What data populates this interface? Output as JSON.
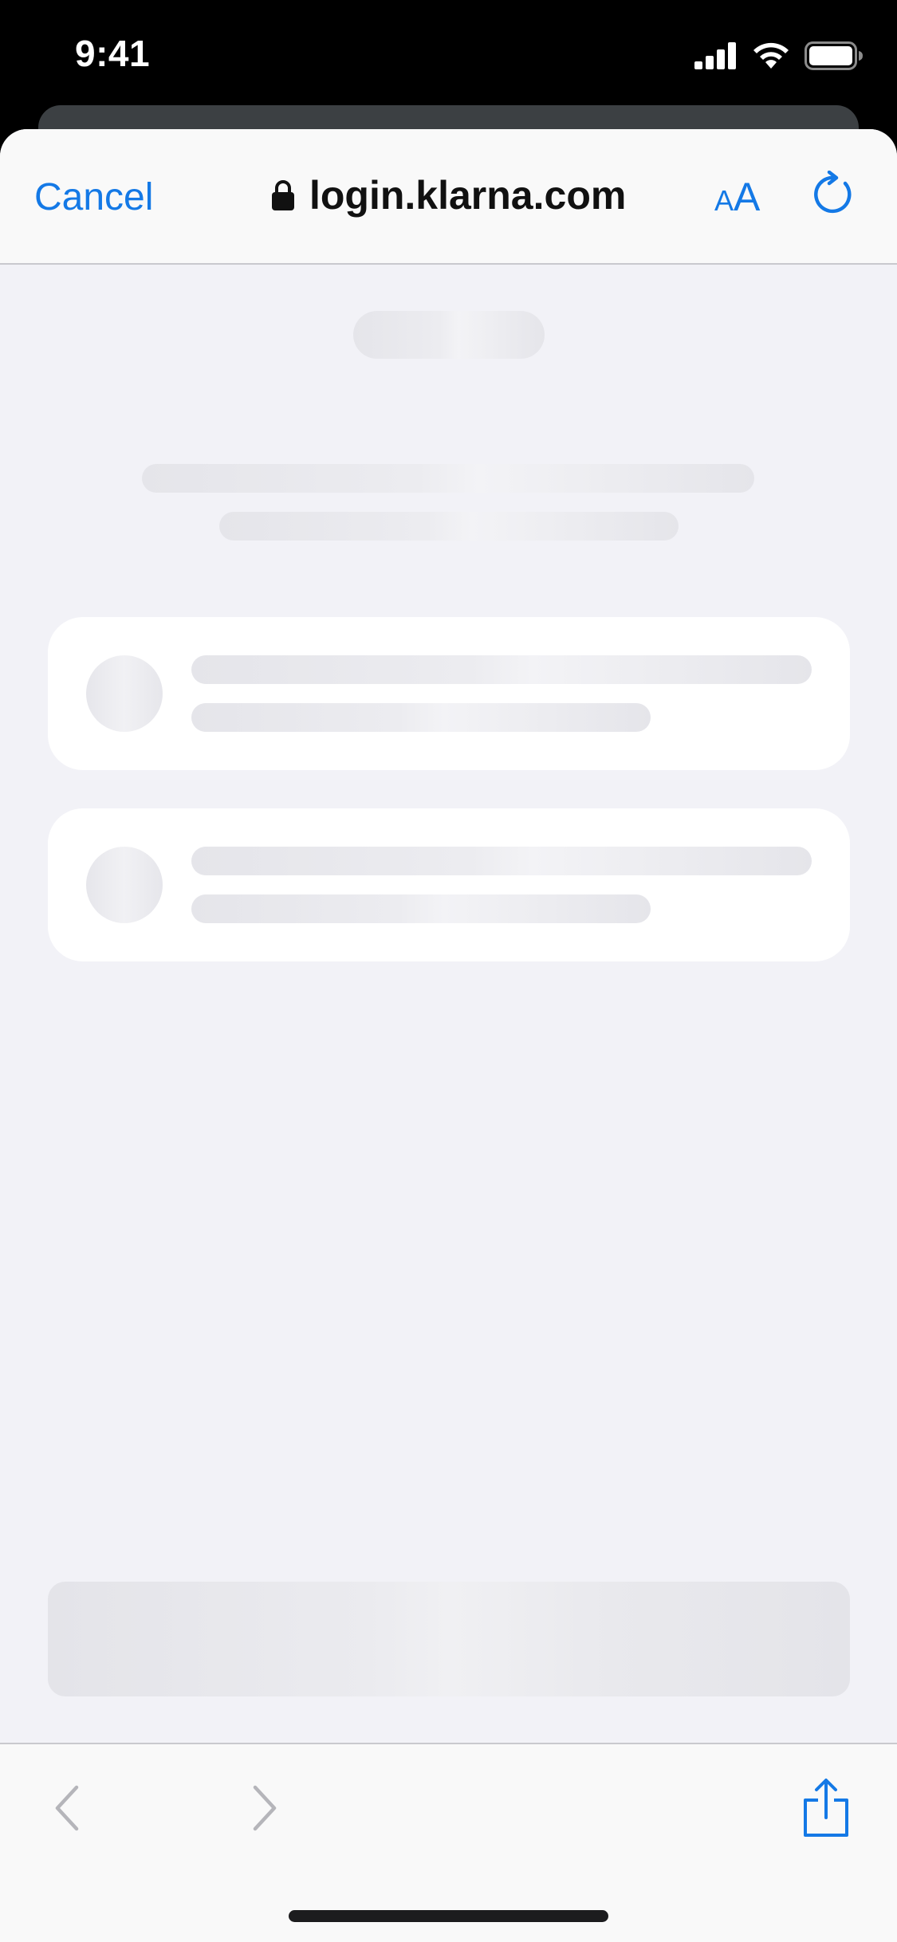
{
  "status_bar": {
    "time": "9:41"
  },
  "nav": {
    "cancel_label": "Cancel",
    "url": "login.klarna.com",
    "text_size_label_small": "A",
    "text_size_label_large": "A"
  },
  "colors": {
    "accent": "#1479e6",
    "sheet_background": "#f2f2f7",
    "bar_background": "#f9f9f9",
    "skeleton": "#e5e5ea"
  },
  "icons": {
    "lock": "lock-icon",
    "reload": "reload-icon",
    "back": "chevron-left-icon",
    "forward": "chevron-right-icon",
    "share": "share-icon",
    "signal": "cellular-signal-icon",
    "wifi": "wifi-icon",
    "battery": "battery-icon"
  }
}
